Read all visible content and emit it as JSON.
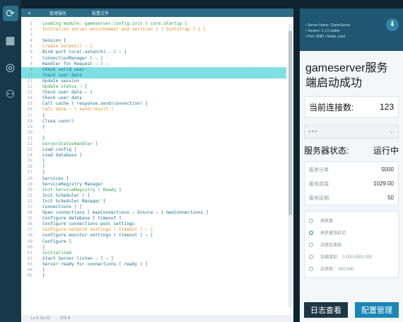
{
  "sidebar": {
    "icons": [
      "refresh-icon",
      "grid-icon",
      "sync-icon",
      "user-icon"
    ]
  },
  "editor": {
    "tab_left": "管理服务",
    "tab_right": "配置文件",
    "status_left": "Ln 9, Col 12",
    "status_right": "UTF-8",
    "lines": [
      {
        "n": "1",
        "t": "Loading module: gameserver.config.init { core.startup }",
        "c": "g"
      },
      {
        "n": "2",
        "t": "Initialize server environment and services } [ bootstrap ] { }",
        "c": "o"
      },
      {
        "n": "3",
        "t": "",
        "c": ""
      },
      {
        "n": "4",
        "t": "Session {",
        "c": ""
      },
      {
        "n": "5",
        "t": "  Create Socket() — ]",
        "c": "o"
      },
      {
        "n": "6",
        "t": "  Bind port local.network(...) — }",
        "c": ""
      },
      {
        "n": "7",
        "t": "  ConnectionManager ( — ]",
        "c": ""
      },
      {
        "n": "8",
        "t": "  Handler for Request — ] —",
        "c": ""
      },
      {
        "n": "9",
        "t": "    Check valid user",
        "c": ""
      },
      {
        "n": "10",
        "t": "    Check user data",
        "c": ""
      },
      {
        "n": "11",
        "t": "    Update session",
        "c": ""
      },
      {
        "n": "12",
        "t": "    Update status — }",
        "c": "g"
      },
      {
        "n": "13",
        "t": "    Check user data — ]",
        "c": ""
      },
      {
        "n": "14",
        "t": "    Check user data",
        "c": ""
      },
      {
        "n": "15",
        "t": "    Call cache ( response.send(connection) }",
        "c": ""
      },
      {
        "n": "16",
        "t": "    Call data — ( send.result )",
        "c": "o"
      },
      {
        "n": "17",
        "t": "    }",
        "c": ""
      },
      {
        "n": "18",
        "t": "    Close conn()",
        "c": ""
      },
      {
        "n": "19",
        "t": "    }",
        "c": ""
      },
      {
        "n": "20",
        "t": "",
        "c": ""
      },
      {
        "n": "21",
        "t": "}",
        "c": ""
      },
      {
        "n": "22",
        "t": "  ServerStatusHandler ]",
        "c": "g"
      },
      {
        "n": "23",
        "t": "    Load config ]",
        "c": ""
      },
      {
        "n": "24",
        "t": "    Load database ]",
        "c": ""
      },
      {
        "n": "25",
        "t": "    }",
        "c": ""
      },
      {
        "n": "26",
        "t": "  }",
        "c": ""
      },
      {
        "n": "27",
        "t": "}",
        "c": ""
      },
      {
        "n": "28",
        "t": "Services {",
        "c": ""
      },
      {
        "n": "29",
        "t": "  ServiceRegistry Manager",
        "c": ""
      },
      {
        "n": "30",
        "t": "    Init ServiceRegistry ( Ready ]",
        "c": "g"
      },
      {
        "n": "31",
        "t": "    Init Scheduler ( ]",
        "c": ""
      },
      {
        "n": "32",
        "t": "    Init Scheduler Manager ]",
        "c": ""
      },
      {
        "n": "33",
        "t": "    Connections ] ]",
        "c": ""
      },
      {
        "n": "34",
        "t": "    Open connections [ maxConnections — Ensure — { maxConnections ]",
        "c": ""
      },
      {
        "n": "35",
        "t": "    Configure database [ timeout ]",
        "c": ""
      },
      {
        "n": "36",
        "t": "    Configure connections pool settings",
        "c": ""
      },
      {
        "n": "37",
        "t": "    Configure network settings ( timeout ] — ]",
        "c": "o"
      },
      {
        "n": "38",
        "t": "    Configure monitor settings ( timeout ] — ]",
        "c": ""
      },
      {
        "n": "39",
        "t": "    Configure ]",
        "c": ""
      },
      {
        "n": "40",
        "t": "  }",
        "c": ""
      },
      {
        "n": "41",
        "t": "  Initialized",
        "c": "g"
      },
      {
        "n": "42",
        "t": "    Start Server listen — ] — ]",
        "c": ""
      },
      {
        "n": "43",
        "t": "    Server ready for connections ( ready ) ]",
        "c": ""
      },
      {
        "n": "44",
        "t": "  }",
        "c": ""
      },
      {
        "n": "45",
        "t": "}",
        "c": ""
      }
    ]
  },
  "panel": {
    "meta": [
      "• Server Name: GameServer",
      "• Version: 2.1.0 stable",
      "• Port: 8080 • Mode: prod"
    ],
    "title": "gameserver服务端启动成功",
    "conn_label": "当前连接数:",
    "conn_value": "123",
    "dropdown_label": "• • •",
    "status_label": "服务器状态:",
    "status_value": "运行中",
    "stats": [
      {
        "k": "服务分单",
        "v": "5000"
      },
      {
        "k": "服务连接",
        "v": "1029:00"
      },
      {
        "k": "服务延期",
        "v": "50"
      }
    ],
    "options": [
      {
        "label": "高质量",
        "sel": false
      },
      {
        "label": "高质量低延迟",
        "sel": true
      },
      {
        "label": "加速加速度",
        "sel": false
      },
      {
        "label": "加速度延：  0.000.0000.000",
        "sel": false
      },
      {
        "label": "加速度：  000.000",
        "sel": false
      }
    ],
    "btn_log": "日志查看",
    "btn_config": "配置管理"
  }
}
